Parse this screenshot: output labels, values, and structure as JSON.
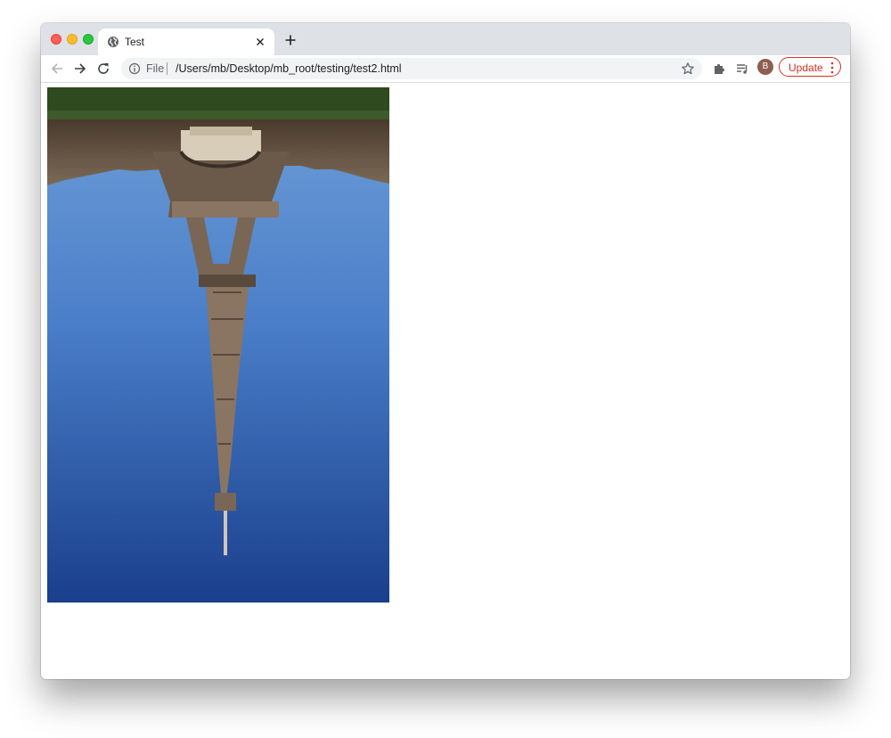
{
  "tab": {
    "title": "Test",
    "favicon": "globe-icon"
  },
  "toolbar": {
    "back": "back-arrow-icon",
    "forward": "forward-arrow-icon",
    "reload": "reload-icon",
    "omnibox": {
      "info_icon": "info-icon",
      "scheme_label": "File",
      "url": "/Users/mb/Desktop/mb_root/testing/test2.html",
      "bookmark_icon": "star-icon"
    },
    "extensions_icon": "puzzle-icon",
    "reading_list_icon": "media-queue-icon",
    "avatar_initial": "B",
    "update_label": "Update"
  },
  "content": {
    "image": {
      "description_icon": "eiffel-tower-upside-down-photo"
    }
  },
  "colors": {
    "tabstrip": "#dee1e6",
    "omnibox": "#f1f3f4",
    "update_accent": "#d93025",
    "avatar": "#8d5e4f",
    "sky_top": "#6b9ad4",
    "sky_bottom": "#1a3f8c"
  }
}
